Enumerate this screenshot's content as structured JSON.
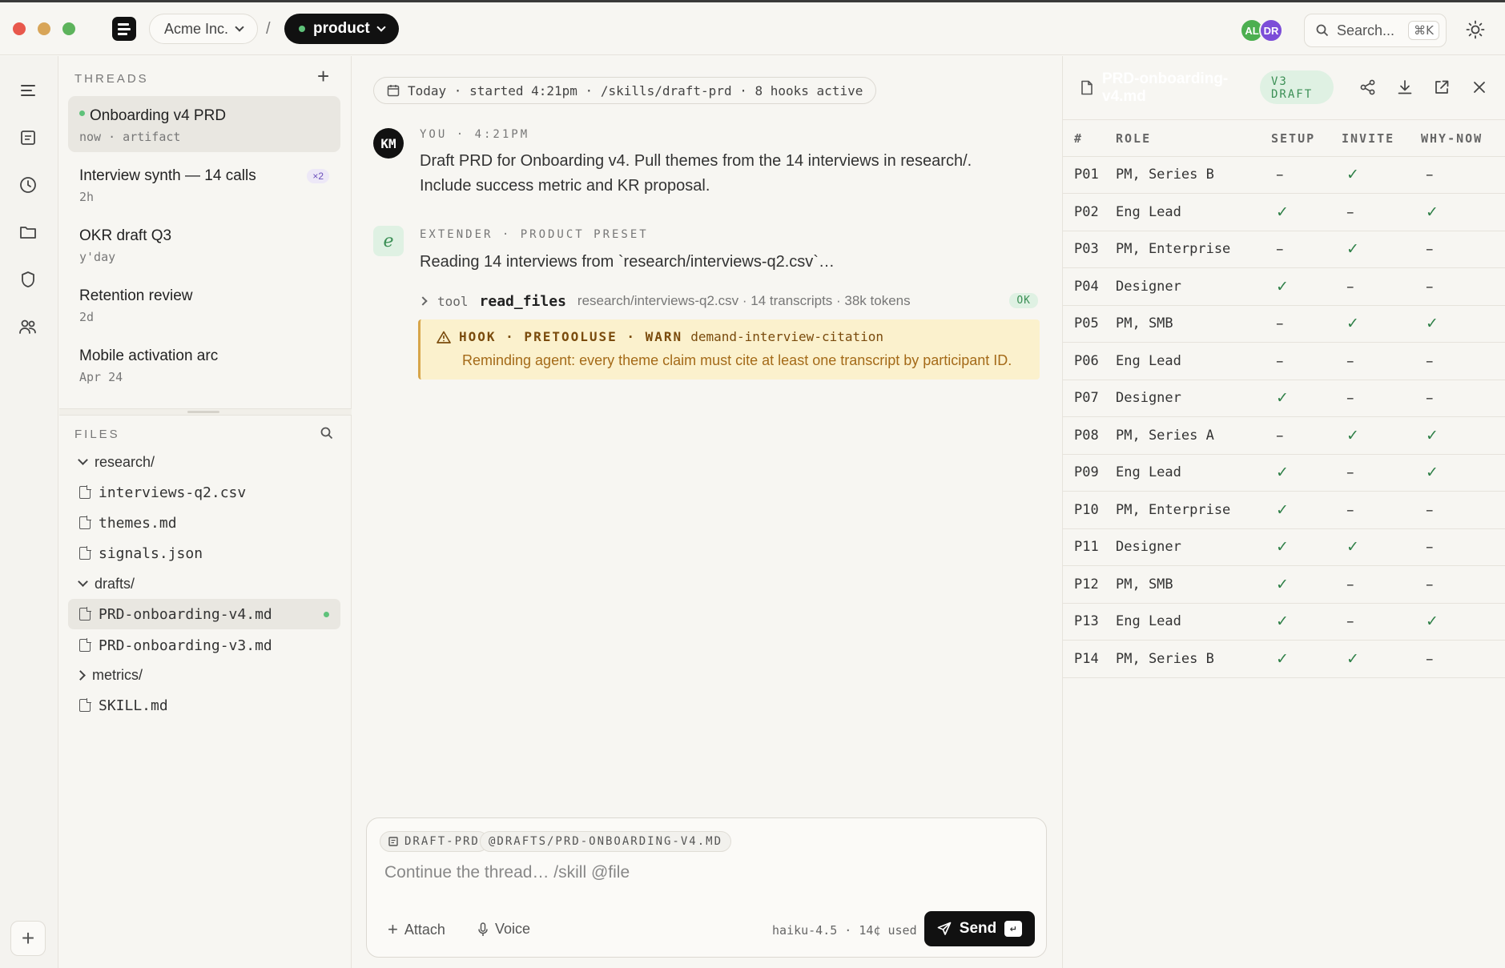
{
  "topbar": {
    "org": "Acme Inc.",
    "separator": "/",
    "project": "product",
    "avatars": [
      {
        "initials": "AL",
        "color": "#4caf50"
      },
      {
        "initials": "DR",
        "color": "#7c4dd8"
      }
    ],
    "search_placeholder": "Search...",
    "search_shortcut": "⌘K"
  },
  "threads": {
    "heading": "THREADS",
    "items": [
      {
        "title": "Onboarding v4 PRD",
        "meta": "now · artifact",
        "active": true,
        "live": true
      },
      {
        "title": "Interview synth — 14 calls",
        "meta": "2h",
        "badge": "×2"
      },
      {
        "title": "OKR draft Q3",
        "meta": "y'day"
      },
      {
        "title": "Retention review",
        "meta": "2d"
      },
      {
        "title": "Mobile activation arc",
        "meta": "Apr 24"
      }
    ]
  },
  "files": {
    "heading": "FILES",
    "items": [
      {
        "name": "research/",
        "type": "folder",
        "open": true
      },
      {
        "name": "interviews-q2.csv",
        "type": "file"
      },
      {
        "name": "themes.md",
        "type": "file"
      },
      {
        "name": "signals.json",
        "type": "file"
      },
      {
        "name": "drafts/",
        "type": "folder",
        "open": true
      },
      {
        "name": "PRD-onboarding-v4.md",
        "type": "file",
        "active": true
      },
      {
        "name": "PRD-onboarding-v3.md",
        "type": "file"
      },
      {
        "name": "metrics/",
        "type": "folder",
        "open": false
      },
      {
        "name": "SKILL.md",
        "type": "file"
      }
    ]
  },
  "chat": {
    "session": "Today · started 4:21pm · /skills/draft-prd · 8 hooks active",
    "user": {
      "avatar": "KM",
      "header": "YOU · 4:21PM",
      "text_line1": "Draft PRD for Onboarding v4. Pull themes from the 14 interviews in research/.",
      "text_line2": "Include success metric and KR proposal."
    },
    "agent": {
      "avatar": "e",
      "header": "EXTENDER · PRODUCT PRESET",
      "text": "Reading 14 interviews from `research/interviews-q2.csv`…"
    },
    "tool": {
      "label": "tool",
      "name": "read_files",
      "detail": "research/interviews-q2.csv · 14 transcripts · 38k tokens",
      "status": "OK"
    },
    "hook": {
      "title": "HOOK · PRETOOLUSE · WARN",
      "name": "demand-interview-citation",
      "message": "Reminding agent: every theme claim must cite at least one transcript by participant ID."
    }
  },
  "composer": {
    "chips": [
      "DRAFT-PRD",
      "@DRAFTS/PRD-ONBOARDING-V4.MD"
    ],
    "placeholder": "Continue the thread… /skill @file",
    "attach": "Attach",
    "voice": "Voice",
    "model": "haiku-4.5 · 14¢ used",
    "send": "Send",
    "send_key": "↵"
  },
  "artifact": {
    "title": "PRD-onboarding-v4.md",
    "version": "V3 DRAFT",
    "columns": [
      "#",
      "ROLE",
      "SETUP",
      "INVITE",
      "WHY-NOW"
    ],
    "rows": [
      [
        "P01",
        "PM, Series B",
        "–",
        "✓",
        "–"
      ],
      [
        "P02",
        "Eng Lead",
        "✓",
        "–",
        "✓"
      ],
      [
        "P03",
        "PM, Enterprise",
        "–",
        "✓",
        "–"
      ],
      [
        "P04",
        "Designer",
        "✓",
        "–",
        "–"
      ],
      [
        "P05",
        "PM, SMB",
        "–",
        "✓",
        "✓"
      ],
      [
        "P06",
        "Eng Lead",
        "–",
        "–",
        "–"
      ],
      [
        "P07",
        "Designer",
        "✓",
        "–",
        "–"
      ],
      [
        "P08",
        "PM, Series A",
        "–",
        "✓",
        "✓"
      ],
      [
        "P09",
        "Eng Lead",
        "✓",
        "–",
        "✓"
      ],
      [
        "P10",
        "PM, Enterprise",
        "✓",
        "–",
        "–"
      ],
      [
        "P11",
        "Designer",
        "✓",
        "✓",
        "–"
      ],
      [
        "P12",
        "PM, SMB",
        "✓",
        "–",
        "–"
      ],
      [
        "P13",
        "Eng Lead",
        "✓",
        "–",
        "✓"
      ],
      [
        "P14",
        "PM, Series B",
        "✓",
        "✓",
        "–"
      ]
    ]
  }
}
